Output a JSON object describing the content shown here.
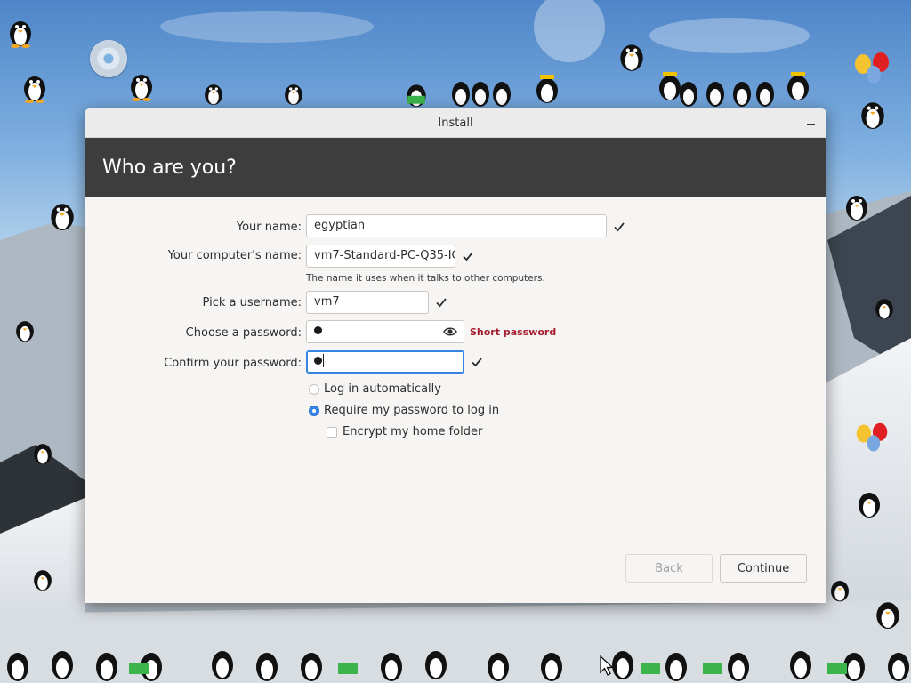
{
  "window": {
    "title": "Install",
    "header_title": "Who are you?"
  },
  "form": {
    "name_label": "Your name:",
    "name_value": "egyptian",
    "computer_label": "Your computer's name:",
    "computer_value": "vm7-Standard-PC-Q35-IC",
    "computer_hint": "The name it uses when it talks to other computers.",
    "username_label": "Pick a username:",
    "username_value": "vm7",
    "password_label": "Choose a password:",
    "password_warning": "Short password",
    "confirm_label": "Confirm your password:",
    "login_auto_label": "Log in automatically",
    "login_require_label": "Require my password to log in",
    "encrypt_label": "Encrypt my home folder",
    "login_mode": "require",
    "encrypt_checked": false
  },
  "buttons": {
    "back_label": "Back",
    "continue_label": "Continue"
  },
  "colors": {
    "accent": "#3584e4",
    "header_bg": "#3d3d3d",
    "warning": "#a51d2d"
  },
  "icons": {
    "check": "check-icon",
    "eye": "eye-icon",
    "minimize": "minimize-icon",
    "disc": "disc-icon"
  }
}
